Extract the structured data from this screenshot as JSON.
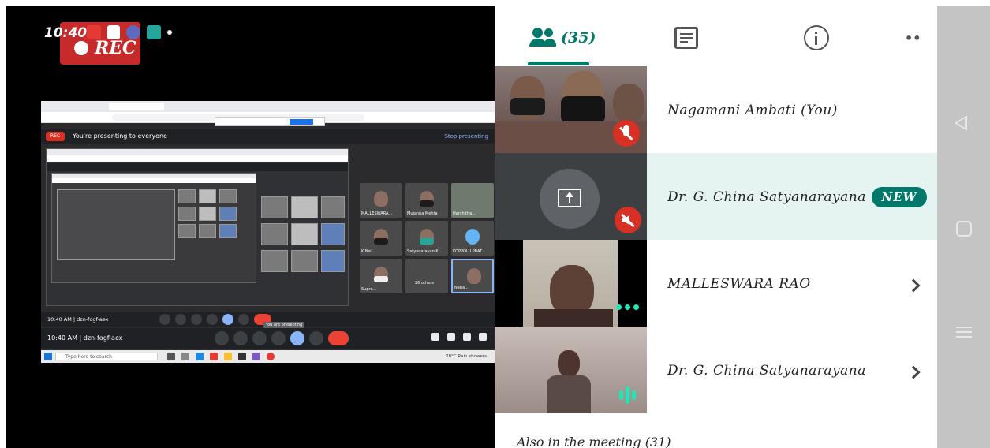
{
  "status_bar": {
    "time": "10:40",
    "rec_label": "REC"
  },
  "shared_screen": {
    "presenting_text": "You're presenting to everyone",
    "stop_presenting": "Stop presenting",
    "share_banner": "You are sharing your entire screen",
    "stop_sharing": "Stop Sharing",
    "tooltip": "You are presenting",
    "meeting_time": "10:40 AM | dzn-fogf-aex",
    "taskbar_search": "Type here to search",
    "taskbar_tray": "28°C Rain showers",
    "tiles": [
      {
        "label": "MALLESWARA..."
      },
      {
        "label": "Mujahna Mehta"
      },
      {
        "label": "Harshitha..."
      },
      {
        "label": "K.Nsi..."
      },
      {
        "label": "Satyanarayan K..."
      },
      {
        "label": "KOPPOLU PRAT..."
      },
      {
        "label": "Supra..."
      },
      {
        "label": "26 others"
      },
      {
        "label": "Nana..."
      }
    ]
  },
  "panel": {
    "participant_count": "(35)",
    "tabs": {
      "people": "people-icon",
      "chat": "chat-icon",
      "info": "info-icon"
    },
    "participants": [
      {
        "name": "Nagamani Ambati (You)",
        "muted": true
      },
      {
        "name": "Dr. G. China Satyanarayana",
        "badge": "NEW",
        "presenting": true
      },
      {
        "name": "MALLESWARA RAO",
        "chevron": true
      },
      {
        "name": "Dr. G. China Satyanarayana",
        "chevron": true,
        "speaking": true
      }
    ],
    "footer": "Also in the meeting (31)"
  },
  "colors": {
    "accent": "#00796b",
    "mute": "#d93025",
    "highlight_row": "#e6f4f1"
  }
}
